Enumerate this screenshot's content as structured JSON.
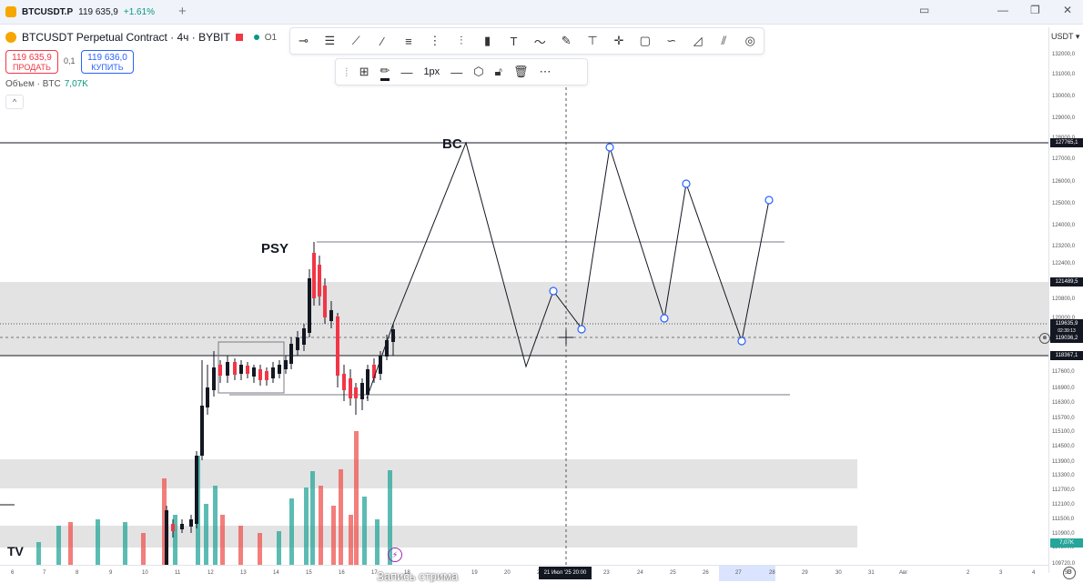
{
  "window": {
    "tab_symbol": "BTCUSDT.P",
    "tab_price": "119 635,9",
    "tab_change": "+1.61%",
    "new_tab": "+",
    "win_controls": [
      "▭",
      "—",
      "❐",
      "✕"
    ]
  },
  "header": {
    "title": "BTCUSDT Perpetual Contract · 4ч · BYBIT",
    "ohlc_hint": "O1"
  },
  "trade": {
    "sell_price": "119 635,9",
    "sell_label": "ПРОДАТЬ",
    "spread": "0,1",
    "buy_price": "119 636,0",
    "buy_label": "КУПИТЬ"
  },
  "volume": {
    "label": "Объем · BTC",
    "value": "7,07K"
  },
  "collapse_icon": "chevron-up-icon",
  "draw_tools": [
    "horizontal-ray-icon",
    "parallel-lines-icon",
    "trendline-icon",
    "ray-icon",
    "fib-icon",
    "grid-icon",
    "bars-pattern-icon",
    "long-position-icon",
    "text-icon",
    "path-icon",
    "brush-icon",
    "measure-icon",
    "crosshair-icon",
    "rectangle-icon",
    "curve-icon",
    "triangle-icon",
    "pitchfork-icon",
    "settings-icon"
  ],
  "style_tools": {
    "width_label": "1px"
  },
  "annotations": {
    "bc": "BC",
    "psy": "PSY"
  },
  "price_axis": {
    "currency": "USDT",
    "ticks": [
      "132000,0",
      "131000,0",
      "130000,0",
      "129000,0",
      "128000,0",
      "127000,0",
      "126000,0",
      "125000,0",
      "124000,0",
      "123200,0",
      "122400,0",
      "120800,0",
      "120000,0",
      "117600,0",
      "116900,0",
      "116300,0",
      "115700,0",
      "115100,0",
      "114500,0",
      "113900,0",
      "113300,0",
      "112700,0",
      "112100,0",
      "111500,0",
      "110900,0",
      "110300,0",
      "109720,0"
    ],
    "labels": {
      "high_line": "127765,1",
      "zone_top": "121489,5",
      "last_price": "119635,9",
      "countdown": "02:39:13",
      "cross_price": "119036,2",
      "zone_bottom": "118367,1",
      "volume_label": "7,07K"
    }
  },
  "time_axis": {
    "ticks": [
      "6",
      "7",
      "8",
      "9",
      "10",
      "11",
      "12",
      "13",
      "14",
      "15",
      "16",
      "17",
      "18",
      "19",
      "20",
      "22",
      "23",
      "24",
      "25",
      "26",
      "27",
      "28",
      "29",
      "30",
      "31",
      "Авг",
      "2",
      "3",
      "4",
      "5"
    ],
    "crosshair_label": "21 Июл '25   20:00"
  },
  "stream_caption": "Запись стрима",
  "tv_logo": "TV"
}
